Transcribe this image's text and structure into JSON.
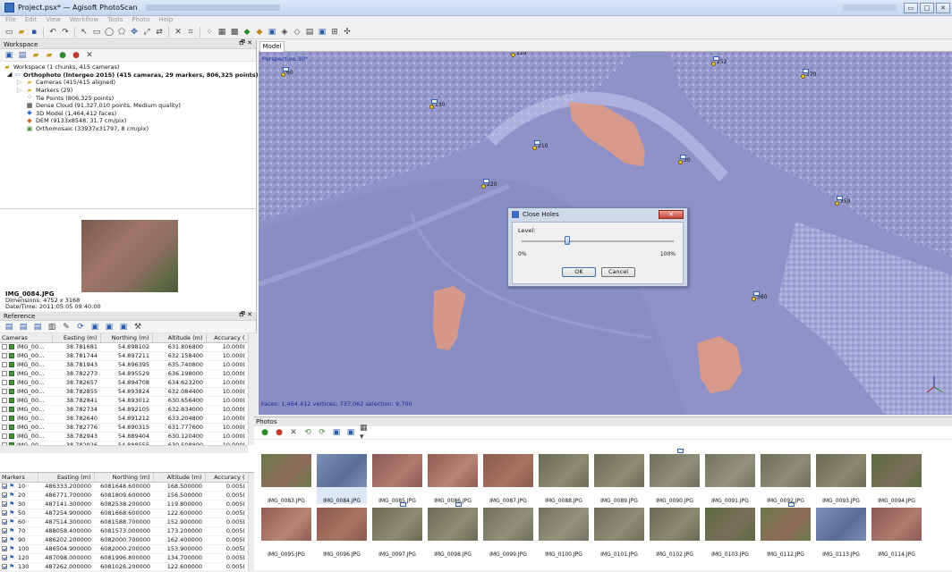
{
  "window": {
    "title": "Project.psx* — Agisoft PhotoScan",
    "buttons": [
      "▭",
      "□",
      "✕"
    ]
  },
  "menu": [
    "File",
    "Edit",
    "View",
    "Workflow",
    "Tools",
    "Photo",
    "Help"
  ],
  "workspace": {
    "title": "Workspace",
    "tree": [
      "Workspace (1 chunks, 415 cameras)",
      "Orthophoto (Intergeo 2015) (415 cameras, 29 markers, 806,325 points) [R]",
      "Cameras (415/415 aligned)",
      "Markers (29)",
      "Tie Points (806,325 points)",
      "Dense Cloud (91,327,010 points, Medium quality)",
      "3D Model (1,464,412 faces)",
      "DEM (9133x8548, 31.7 cm/pix)",
      "Orthomosaic (33937x31797, 8 cm/pix)"
    ]
  },
  "preview": {
    "name": "IMG_0084.JPG",
    "dimensions": "Dimensions: 4752 x 3168",
    "datetime": "Date/Time: 2011:05:05 09:40:00"
  },
  "reference": {
    "title": "Reference",
    "cameras_headers": [
      "Cameras",
      "Easting (m)",
      "Northing (m)",
      "Altitude (m)",
      "Accuracy ("
    ],
    "cameras": [
      [
        "IMG_00...",
        "38.781681",
        "54.898102",
        "631.806800",
        "10.000("
      ],
      [
        "IMG_00...",
        "38.781744",
        "54.897211",
        "632.158400",
        "10.000("
      ],
      [
        "IMG_00...",
        "38.781943",
        "54.896395",
        "635.740800",
        "10.000("
      ],
      [
        "IMG_00...",
        "38.782273",
        "54.895529",
        "636.198000",
        "10.000("
      ],
      [
        "IMG_00...",
        "38.782657",
        "54.894708",
        "634.623200",
        "10.000("
      ],
      [
        "IMG_00...",
        "38.782855",
        "54.893824",
        "632.084400",
        "10.000("
      ],
      [
        "IMG_00...",
        "38.782841",
        "54.893012",
        "630.656400",
        "10.000("
      ],
      [
        "IMG_00...",
        "38.782734",
        "54.892105",
        "632.834000",
        "10.000("
      ],
      [
        "IMG_00...",
        "38.782640",
        "54.891212",
        "633.204800",
        "10.000("
      ],
      [
        "IMG_00...",
        "38.782776",
        "54.890315",
        "631.777600",
        "10.000("
      ],
      [
        "IMG_00...",
        "38.782943",
        "54.889404",
        "630.120400",
        "10.000("
      ],
      [
        "IMG_00...",
        "38.782926",
        "54.888555",
        "630.508800",
        "10.000("
      ]
    ],
    "markers_headers": [
      "Markers",
      "Easting (m)",
      "Northing (m)",
      "Altitude (m)",
      "Accuracy ("
    ],
    "markers": [
      [
        "10",
        "486333.200000",
        "6081648.600000",
        "168.500000",
        "0.005("
      ],
      [
        "20",
        "486771.700000",
        "6081809.600000",
        "156.500000",
        "0.005("
      ],
      [
        "30",
        "487141.300000",
        "6082538.200000",
        "119.800000",
        "0.005("
      ],
      [
        "50",
        "487254.900000",
        "6081668.600000",
        "122.600000",
        "0.005("
      ],
      [
        "60",
        "487514.300000",
        "6081588.700000",
        "152.900000",
        "0.005("
      ],
      [
        "70",
        "488058.400000",
        "6081573.000000",
        "173.200000",
        "0.005("
      ],
      [
        "90",
        "486202.200000",
        "6082000.700000",
        "162.400000",
        "0.005("
      ],
      [
        "100",
        "486504.900000",
        "6082000.200000",
        "153.900000",
        "0.005("
      ],
      [
        "120",
        "487098.000000",
        "6081996.800000",
        "134.700000",
        "0.005("
      ],
      [
        "130",
        "487262.000000",
        "6081026.200000",
        "122.600000",
        "0.005("
      ]
    ]
  },
  "model": {
    "tab": "Model",
    "projection": "Perspective 30°",
    "stats": "Faces: 1,464,412 vertices: 737,062 selection: 9,700",
    "markers": [
      "60",
      "120",
      "252",
      "270",
      "130",
      "210",
      "30",
      "220",
      "350",
      "360"
    ]
  },
  "dialog": {
    "title": "Close Holes",
    "level_label": "Level:",
    "min": "0%",
    "max": "100%",
    "ok": "OK",
    "cancel": "Cancel",
    "level_value": 0.3
  },
  "photos": {
    "title": "Photos",
    "row1": [
      "IMG_0083.JPG",
      "IMG_0084.JPG",
      "IMG_0085.JPG",
      "IMG_0086.JPG",
      "IMG_0087.JPG",
      "IMG_0088.JPG",
      "IMG_0089.JPG",
      "IMG_0090.JPG",
      "IMG_0091.JPG",
      "IMG_0092.JPG",
      "IMG_0093.JPG",
      "IMG_0094.JPG"
    ],
    "row2": [
      "IMG_0095.JPG",
      "IMG_0096.JPG",
      "IMG_0097.JPG",
      "IMG_0098.JPG",
      "IMG_0099.JPG",
      "IMG_0100.JPG",
      "IMG_0101.JPG",
      "IMG_0102.JPG",
      "IMG_0103.JPG",
      "IMG_0112.JPG",
      "IMG_0113.JPG",
      "IMG_0114.JPG"
    ]
  }
}
